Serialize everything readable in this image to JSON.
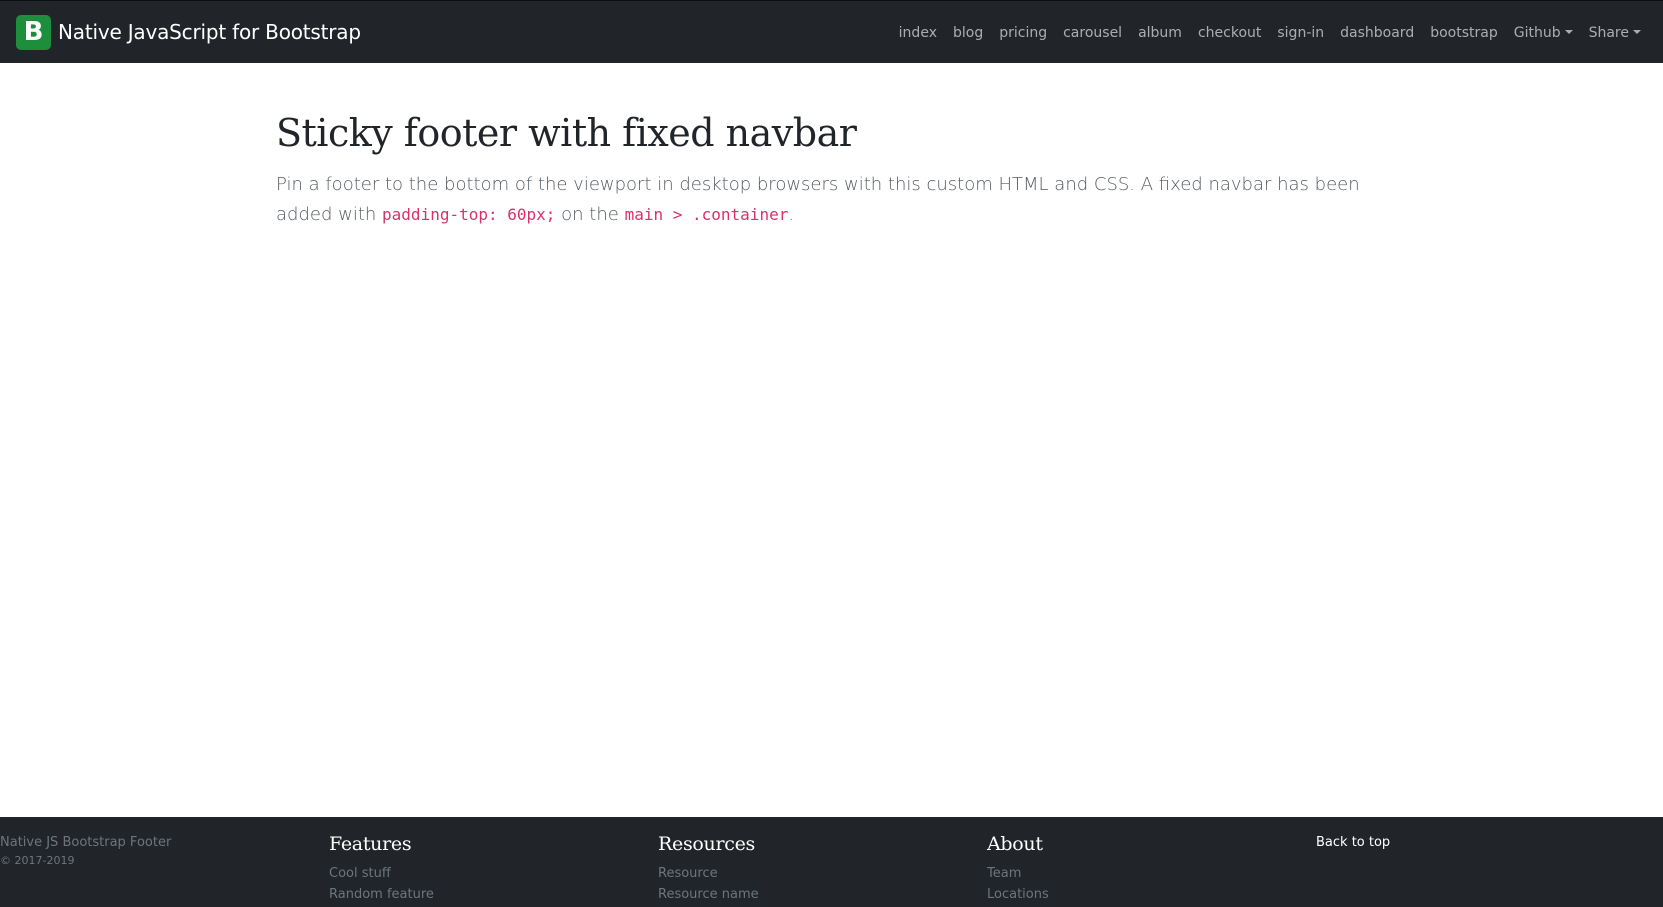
{
  "navbar": {
    "brand_logo": "B",
    "brand_name": "Native JavaScript for Bootstrap",
    "links": [
      "index",
      "blog",
      "pricing",
      "carousel",
      "album",
      "checkout",
      "sign-in",
      "dashboard",
      "bootstrap"
    ],
    "dropdowns": [
      "Github",
      "Share"
    ]
  },
  "main": {
    "title": "Sticky footer with fixed navbar",
    "lead_text_1": "Pin a footer to the bottom of the viewport in desktop browsers with this custom HTML and CSS. A fixed navbar has been added with",
    "code_1": "padding-top: 60px;",
    "lead_text_2": "on the",
    "code_2": "main > .container",
    "lead_text_3": "."
  },
  "footer": {
    "brand": "Native JS Bootstrap Footer",
    "copyright": "© 2017-2019",
    "features": {
      "heading": "Features",
      "items": [
        "Cool stuff",
        "Random feature"
      ]
    },
    "resources": {
      "heading": "Resources",
      "items": [
        "Resource",
        "Resource name"
      ]
    },
    "about": {
      "heading": "About",
      "items": [
        "Team",
        "Locations"
      ]
    },
    "back_to_top": "Back to top"
  },
  "colors": {
    "navbar_bg": "#212529",
    "brand_green": "#1d8f3c",
    "code_pink": "#d6336c"
  }
}
